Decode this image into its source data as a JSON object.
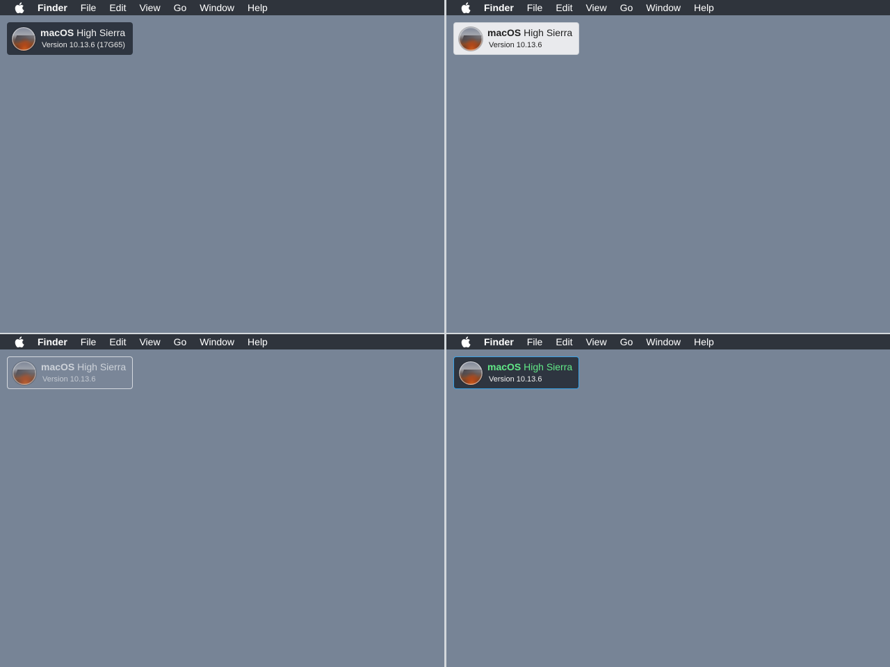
{
  "menubar": {
    "icon": "apple-logo-icon",
    "app_name": "Finder",
    "items": [
      "File",
      "Edit",
      "View",
      "Go",
      "Window",
      "Help"
    ]
  },
  "panels": [
    {
      "variant": "dark",
      "widget": {
        "os": "macOS",
        "name": "High Sierra",
        "version": "Version 10.13.6 (17G65)"
      }
    },
    {
      "variant": "light",
      "widget": {
        "os": "macOS",
        "name": "High Sierra",
        "version": "Version 10.13.6"
      }
    },
    {
      "variant": "outline",
      "widget": {
        "os": "macOS",
        "name": "High Sierra",
        "version": "Version 10.13.6"
      }
    },
    {
      "variant": "accent",
      "widget": {
        "os": "macOS",
        "name": "High Sierra",
        "version": "Version 10.13.6"
      }
    }
  ],
  "colors": {
    "desktop": "#778496",
    "menubar": "#2f343c",
    "divider": "#d4d8dc",
    "accent_green": "#61e887",
    "accent_blue_border": "#3aa3e8"
  }
}
